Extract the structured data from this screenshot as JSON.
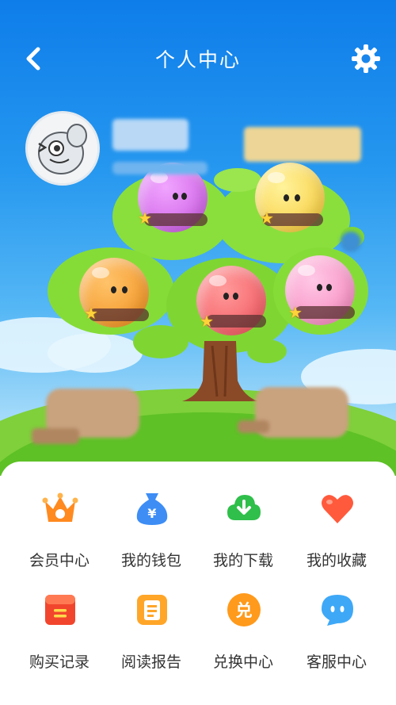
{
  "header": {
    "title": "个人中心",
    "back_icon": "chevron-left-icon",
    "settings_icon": "gear-icon"
  },
  "colors": {
    "sky_top": "#0e7dea",
    "panel_bg": "#ffffff",
    "label_text": "#333333"
  },
  "menu": {
    "items": [
      {
        "label": "会员中心",
        "icon": "crown-icon",
        "color": "#ff8a1f"
      },
      {
        "label": "我的钱包",
        "icon": "money-bag-icon",
        "color": "#3d8df5"
      },
      {
        "label": "我的下载",
        "icon": "cloud-download-icon",
        "color": "#2fbf4a"
      },
      {
        "label": "我的收藏",
        "icon": "heart-icon",
        "color": "#ff5a3c"
      },
      {
        "label": "购买记录",
        "icon": "receipt-icon",
        "color": "#f2452d"
      },
      {
        "label": "阅读报告",
        "icon": "report-icon",
        "color": "#ffa629"
      },
      {
        "label": "兑换中心",
        "icon": "exchange-icon",
        "color": "#ff9a1c"
      },
      {
        "label": "客服中心",
        "icon": "chat-bubble-icon",
        "color": "#3ea8f7"
      }
    ],
    "exchange_glyph": "兑",
    "wallet_glyph": "¥"
  }
}
